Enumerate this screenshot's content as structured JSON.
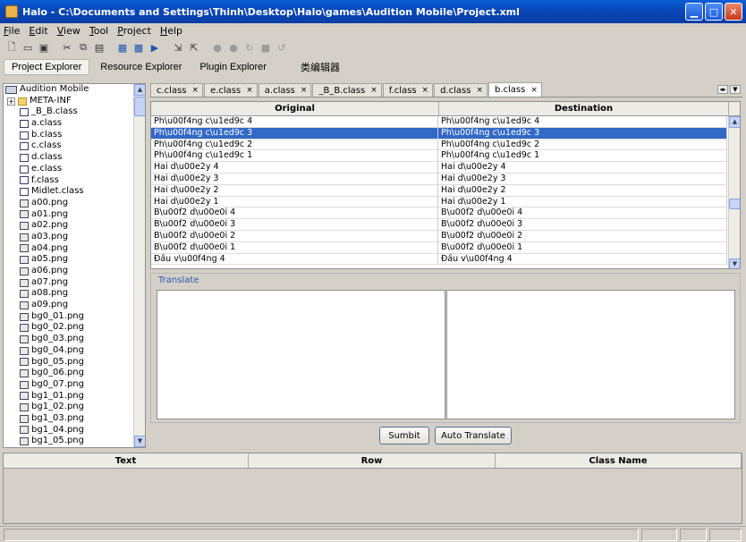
{
  "window": {
    "title": "Halo - C:\\Documents and Settings\\Thinh\\Desktop\\Halo\\games\\Audition Mobile\\Project.xml"
  },
  "menu": [
    "File",
    "Edit",
    "View",
    "Tool",
    "Project",
    "Help"
  ],
  "panel_tabs": [
    "Project Explorer",
    "Resource Explorer",
    "Plugin Explorer",
    "类编辑器"
  ],
  "tree": {
    "root": "Audition Mobile",
    "items": [
      "META-INF",
      "_B_B.class",
      "a.class",
      "b.class",
      "c.class",
      "d.class",
      "e.class",
      "f.class",
      "Midlet.class",
      "a00.png",
      "a01.png",
      "a02.png",
      "a03.png",
      "a04.png",
      "a05.png",
      "a06.png",
      "a07.png",
      "a08.png",
      "a09.png",
      "bg0_01.png",
      "bg0_02.png",
      "bg0_03.png",
      "bg0_04.png",
      "bg0_05.png",
      "bg0_06.png",
      "bg0_07.png",
      "bg1_01.png",
      "bg1_02.png",
      "bg1_03.png",
      "bg1_04.png",
      "bg1_05.png"
    ]
  },
  "editor_tabs": [
    "c.class",
    "e.class",
    "a.class",
    "_B_B.class",
    "f.class",
    "d.class",
    "b.class"
  ],
  "active_tab": "b.class",
  "grid": {
    "headers": [
      "Original",
      "Destination"
    ],
    "rows": [
      [
        "Ph\\u00f4ng c\\u1ed9c 4",
        "Ph\\u00f4ng c\\u1ed9c 4"
      ],
      [
        "Ph\\u00f4ng c\\u1ed9c 3",
        "Ph\\u00f4ng c\\u1ed9c 3"
      ],
      [
        "Ph\\u00f4ng c\\u1ed9c 2",
        "Ph\\u00f4ng c\\u1ed9c 2"
      ],
      [
        "Ph\\u00f4ng c\\u1ed9c 1",
        "Ph\\u00f4ng c\\u1ed9c 1"
      ],
      [
        "Hai d\\u00e2y 4",
        "Hai d\\u00e2y 4"
      ],
      [
        "Hai d\\u00e2y 3",
        "Hai d\\u00e2y 3"
      ],
      [
        "Hai d\\u00e2y 2",
        "Hai d\\u00e2y 2"
      ],
      [
        "Hai d\\u00e2y 1",
        "Hai d\\u00e2y 1"
      ],
      [
        "B\\u00f2 d\\u00e0i 4",
        "B\\u00f2 d\\u00e0i 4"
      ],
      [
        "B\\u00f2 d\\u00e0i 3",
        "B\\u00f2 d\\u00e0i 3"
      ],
      [
        "B\\u00f2 d\\u00e0i 2",
        "B\\u00f2 d\\u00e0i 2"
      ],
      [
        "B\\u00f2 d\\u00e0i 1",
        "B\\u00f2 d\\u00e0i 1"
      ],
      [
        "Đầu v\\u00f4ng 4",
        "Đầu v\\u00f4ng 4"
      ]
    ],
    "selected_row": 1
  },
  "translate": {
    "label": "Translate"
  },
  "buttons": {
    "submit": "Sumbit",
    "auto_translate": "Auto Translate"
  },
  "results_headers": [
    "Text",
    "Row",
    "Class Name"
  ],
  "colors": {
    "titlebar": "#0846b8",
    "selection": "#3169c6",
    "accent_label": "#2a5ab0"
  }
}
